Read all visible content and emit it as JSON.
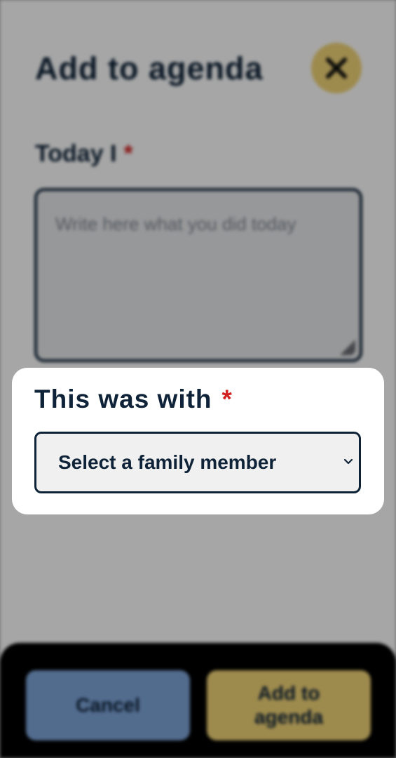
{
  "modal": {
    "title": "Add to agenda",
    "close_icon": "close-icon"
  },
  "today_field": {
    "label": "Today I",
    "required_marker": "*",
    "placeholder": "Write here what you did today"
  },
  "with_field": {
    "label": "This was with",
    "required_marker": "*",
    "selected_value": "Select a family member",
    "dropdown_icon": "chevron-down-icon"
  },
  "footer": {
    "cancel_label": "Cancel",
    "add_label": "Add to agenda"
  },
  "colors": {
    "navy": "#0f2338",
    "accent_yellow": "#f2d577",
    "cancel_blue": "#7fa6db",
    "required_red": "#d22020"
  }
}
